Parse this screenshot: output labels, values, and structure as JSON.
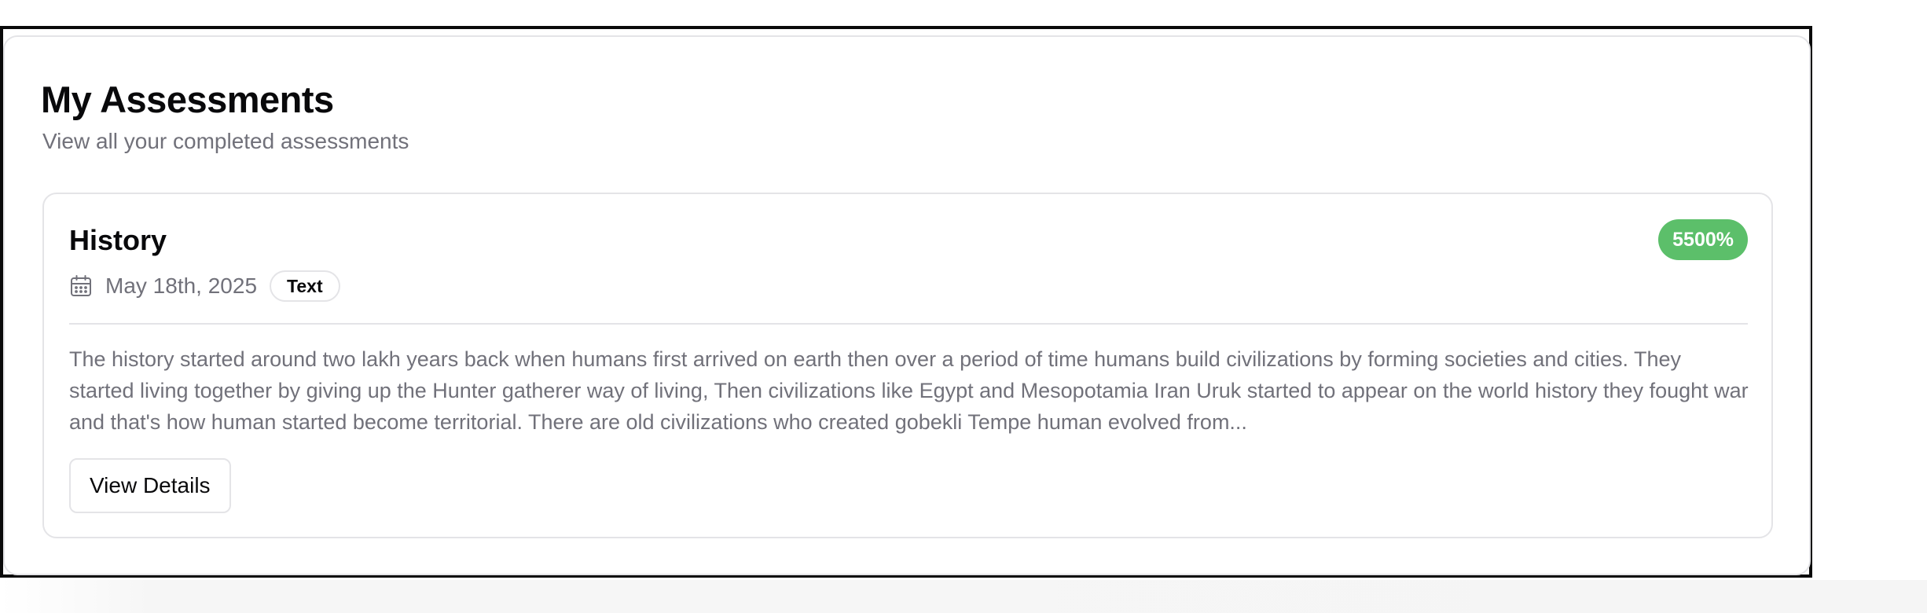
{
  "header": {
    "title": "My Assessments",
    "subtitle": "View all your completed assessments"
  },
  "assessment": {
    "title": "History",
    "score": "5500%",
    "date": "May 18th, 2025",
    "type": "Text",
    "excerpt": "The history started around two lakh years back when humans first arrived on earth then over a period of time humans build civilizations by forming societies and cities. They started living together by giving up the Hunter gatherer way of living, Then civilizations like Egypt and Mesopotamia Iran Uruk started to appear on the world history they fought war and that's how human started become territorial. There are old civilizations who created gobekli Tempe human evolved from...",
    "action_label": "View Details"
  },
  "icons": {
    "date_icon": "calendar-icon"
  },
  "colors": {
    "score_badge": "#5cbf6a",
    "muted_text": "#71717a",
    "border": "#e4e4e7",
    "heading": "#09090b"
  }
}
